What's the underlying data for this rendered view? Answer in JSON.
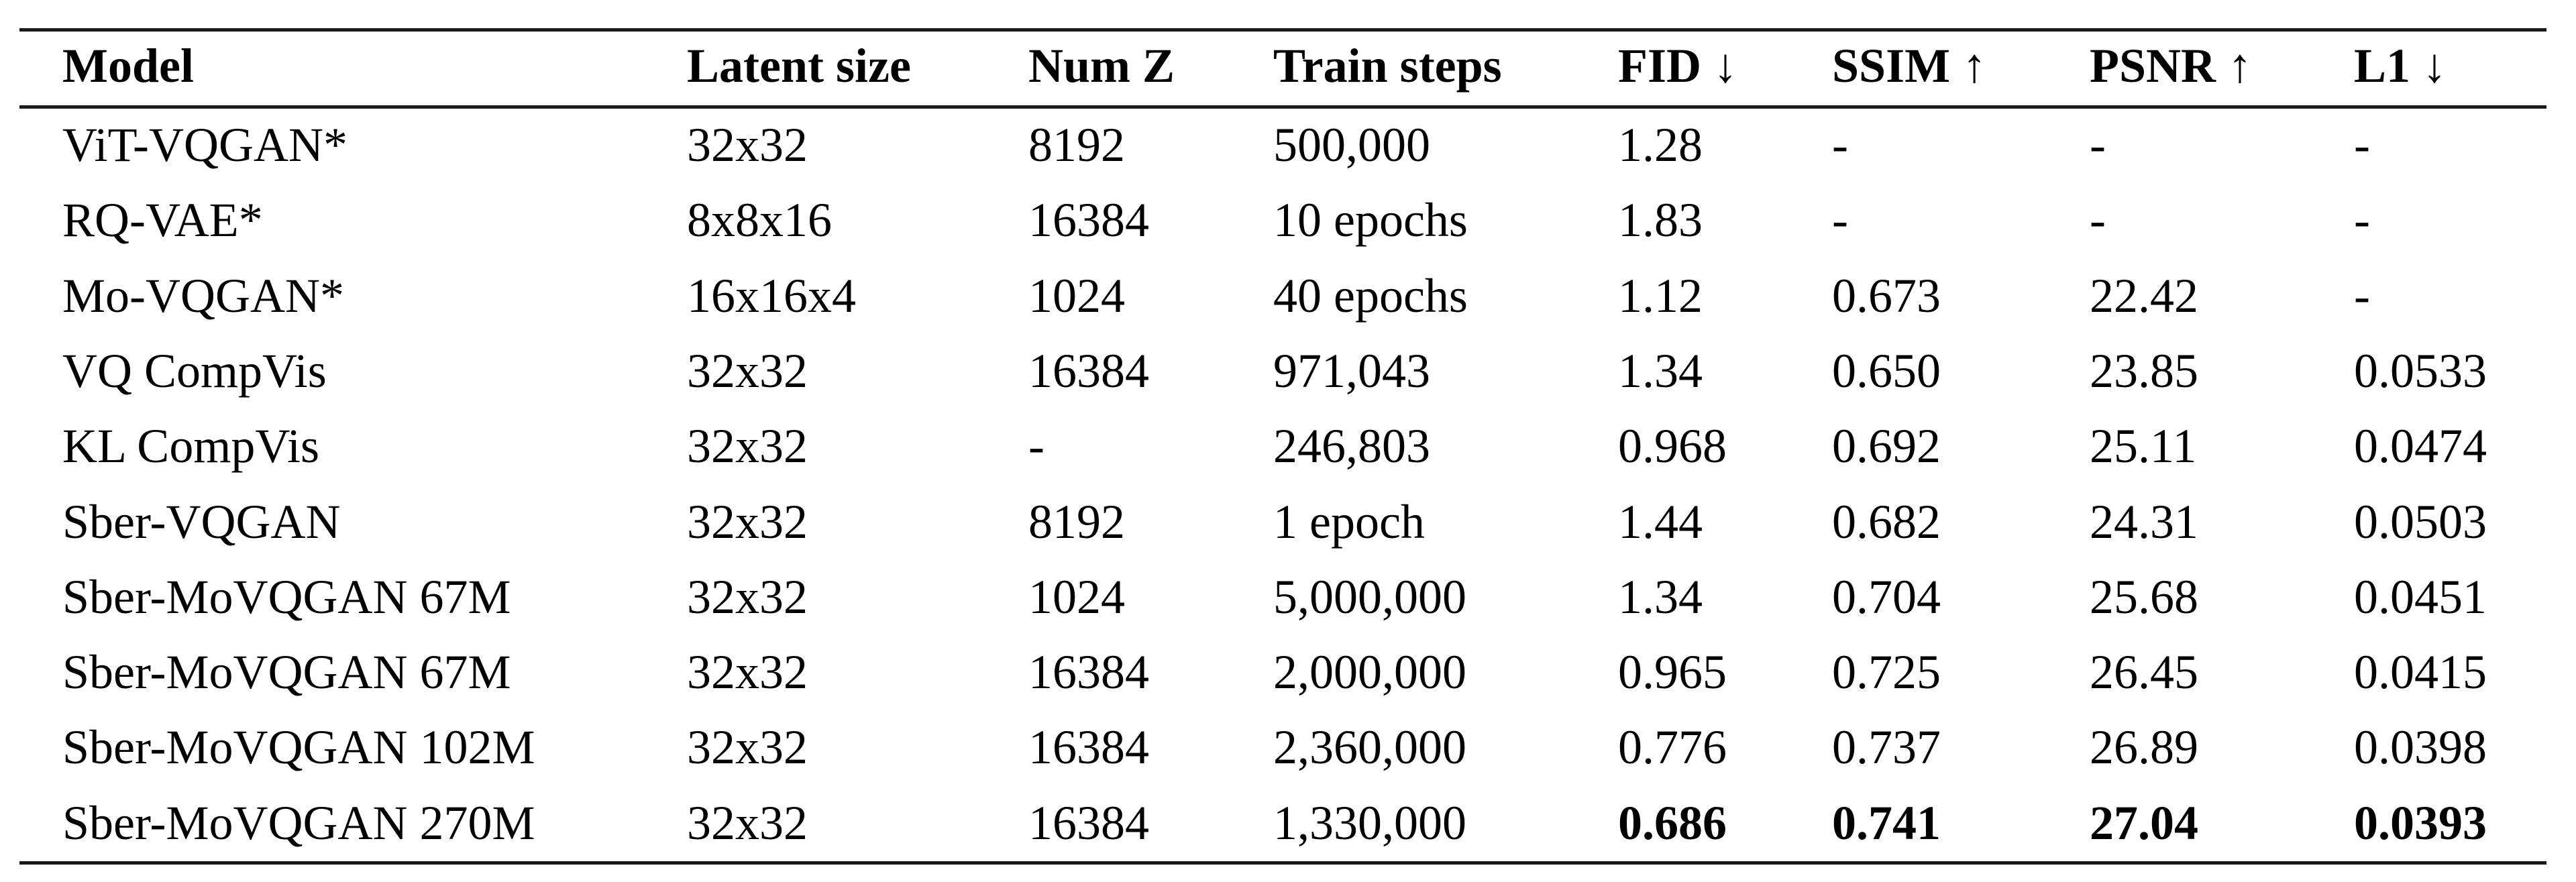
{
  "table": {
    "headers": [
      "Model",
      "Latent size",
      "Num Z",
      "Train steps",
      "FID ↓",
      "SSIM ↑",
      "PSNR ↑",
      "L1 ↓"
    ],
    "rows": [
      [
        "ViT-VQGAN*",
        "32x32",
        "8192",
        "500,000",
        "1.28",
        "-",
        "-",
        "-"
      ],
      [
        "RQ-VAE*",
        "8x8x16",
        "16384",
        "10 epochs",
        "1.83",
        "-",
        "-",
        "-"
      ],
      [
        "Mo-VQGAN*",
        "16x16x4",
        "1024",
        "40 epochs",
        "1.12",
        "0.673",
        "22.42",
        "-"
      ],
      [
        "VQ CompVis",
        "32x32",
        "16384",
        "971,043",
        "1.34",
        "0.650",
        "23.85",
        "0.0533"
      ],
      [
        "KL CompVis",
        "32x32",
        "-",
        "246,803",
        "0.968",
        "0.692",
        "25.11",
        "0.0474"
      ],
      [
        "Sber-VQGAN",
        "32x32",
        "8192",
        "1 epoch",
        "1.44",
        "0.682",
        "24.31",
        "0.0503"
      ],
      [
        "Sber-MoVQGAN 67M",
        "32x32",
        "1024",
        "5,000,000",
        "1.34",
        "0.704",
        "25.68",
        "0.0451"
      ],
      [
        "Sber-MoVQGAN 67M",
        "32x32",
        "16384",
        "2,000,000",
        "0.965",
        "0.725",
        "26.45",
        "0.0415"
      ],
      [
        "Sber-MoVQGAN 102M",
        "32x32",
        "16384",
        "2,360,000",
        "0.776",
        "0.737",
        "26.89",
        "0.0398"
      ],
      [
        "Sber-MoVQGAN 270M",
        "32x32",
        "16384",
        "1,330,000",
        "0.686",
        "0.741",
        "27.04",
        "0.0393"
      ]
    ],
    "bold_cells": [
      [
        9,
        4
      ],
      [
        9,
        5
      ],
      [
        9,
        6
      ],
      [
        9,
        7
      ]
    ]
  }
}
